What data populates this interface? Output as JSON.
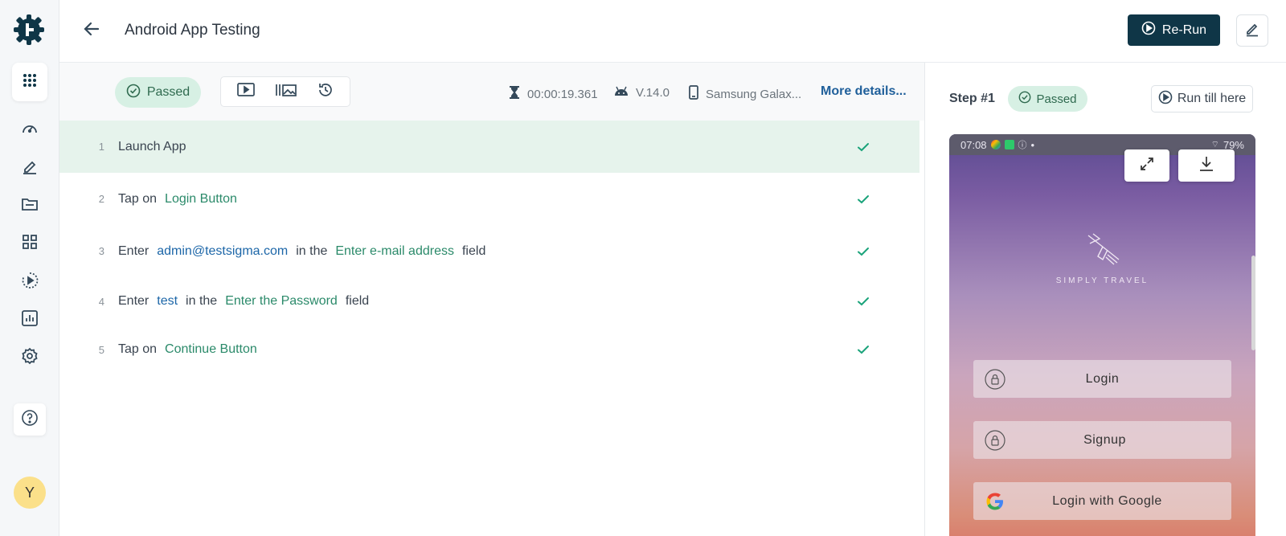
{
  "header": {
    "title": "Android App Testing",
    "rerun_label": "Re-Run"
  },
  "toolbar": {
    "status": "Passed",
    "duration": "00:00:19.361",
    "os_version": "V.14.0",
    "device": "Samsung Galax...",
    "more_details": "More details..."
  },
  "steps": [
    {
      "num": "1",
      "parts": [
        {
          "t": "kw",
          "v": "Launch App"
        }
      ]
    },
    {
      "num": "2",
      "parts": [
        {
          "t": "kw",
          "v": "Tap on"
        },
        {
          "t": "el",
          "v": "Login Button"
        }
      ]
    },
    {
      "num": "3",
      "parts": [
        {
          "t": "kw",
          "v": "Enter"
        },
        {
          "t": "val",
          "v": "admin@testsigma.com"
        },
        {
          "t": "kw",
          "v": "in the"
        },
        {
          "t": "el",
          "v": "Enter e-mail address"
        },
        {
          "t": "kw",
          "v": "field"
        }
      ]
    },
    {
      "num": "4",
      "parts": [
        {
          "t": "kw",
          "v": "Enter"
        },
        {
          "t": "val",
          "v": "test"
        },
        {
          "t": "kw",
          "v": "in the"
        },
        {
          "t": "el",
          "v": "Enter the Password"
        },
        {
          "t": "kw",
          "v": "field"
        }
      ]
    },
    {
      "num": "5",
      "parts": [
        {
          "t": "kw",
          "v": "Tap on"
        },
        {
          "t": "el",
          "v": "Continue Button"
        }
      ]
    }
  ],
  "right_pane": {
    "step_label": "Step #1",
    "status": "Passed",
    "run_till_here": "Run till here"
  },
  "phone": {
    "time": "07:08",
    "battery": "79%",
    "brand": "SIMPLY TRAVEL",
    "buttons": [
      "Login",
      "Signup",
      "Login with Google"
    ]
  },
  "avatar_initial": "Y",
  "colors": {
    "accent_dark": "#0f3647",
    "success_bg": "#d7f0e4",
    "success": "#1aa37a",
    "link": "#1f5f9a",
    "element_text": "#2b8a6a",
    "value_text": "#1c66a8"
  },
  "icons": [
    "logo-gear-icon",
    "apps-grid-icon",
    "dashboard-icon",
    "edit-icon",
    "folder-icon",
    "modules-icon",
    "run-icon",
    "reports-icon",
    "settings-icon",
    "help-icon",
    "back-arrow-icon",
    "play-circle-icon",
    "video-icon",
    "screenshots-icon",
    "history-icon",
    "hourglass-icon",
    "android-icon",
    "phone-icon",
    "check-icon",
    "expand-icon",
    "download-icon",
    "lock-icon",
    "google-icon"
  ]
}
